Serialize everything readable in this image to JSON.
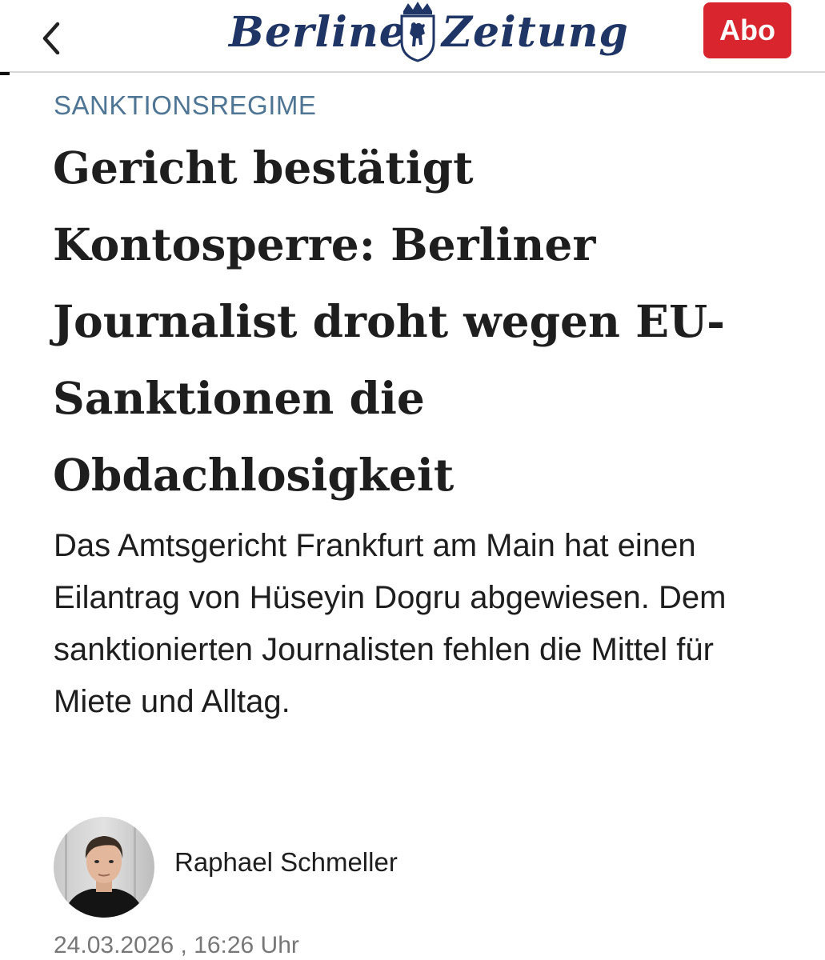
{
  "header": {
    "logo_left": "Berliner",
    "logo_right": "Zeitung",
    "abo_label": "Abo",
    "back_icon": "chevron-left-icon",
    "crest_icon": "bear-crest-icon",
    "brand_color": "#1f3566",
    "abo_color": "#d9252e"
  },
  "article": {
    "kicker": "SANKTIONSREGIME",
    "headline": "Gericht bestätigt Kontosperre: Berliner Journalist droht wegen EU-Sanktionen die Obdachlosigkeit",
    "teaser": "Das Amtsgericht Frankfurt am Main hat einen Eilantrag von Hüseyin Dogru abgewiesen. Dem sanktionierten Journalisten fehlen die Mittel für Miete und Alltag.",
    "kicker_color": "#4f7594"
  },
  "byline": {
    "author": "Raphael Schmeller",
    "date": "24.03.2026 , 16:26 Uhr"
  }
}
